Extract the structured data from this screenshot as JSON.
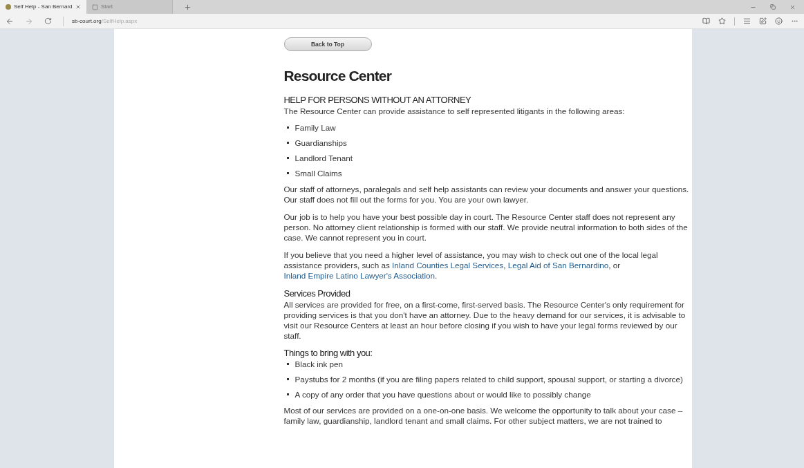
{
  "tabs": [
    {
      "title": "Self Help - San Bernard",
      "selected": true
    },
    {
      "title": "Start",
      "selected": false
    }
  ],
  "address": {
    "domain": "sb-court.org",
    "path": "/SelfHelp.aspx"
  },
  "page": {
    "back_button": "Back to Top",
    "title": "Resource Center",
    "blocks": [
      {
        "kind": "subheading",
        "text": "HELP FOR PERSONS WITHOUT AN ATTORNEY"
      },
      {
        "kind": "lead",
        "parts": [
          {
            "kind": "text",
            "text": "The Resource Center can provide assistance to self represented litigants in the following areas:"
          }
        ]
      },
      {
        "kind": "list",
        "items": [
          "Family Law",
          "Guardianships",
          "Landlord Tenant",
          "Small Claims"
        ]
      },
      {
        "kind": "paragraph",
        "parts": [
          {
            "kind": "text",
            "text": "Our staff of attorneys, paralegals and self help assistants can review your documents and answer your questions. Our staff does not fill out the forms for you. You are your own lawyer."
          }
        ]
      },
      {
        "kind": "paragraph",
        "parts": [
          {
            "kind": "text",
            "text": "Our job is to help you have your best possible day in court. The Resource Center staff does not represent any person. No attorney client relationship is formed with our staff. We provide neutral information to both sides of the case. We cannot represent you in court."
          }
        ]
      },
      {
        "kind": "paragraph",
        "parts": [
          {
            "kind": "text",
            "text": "If you believe that you need a higher level of assistance, you may wish to check out one of the local legal assistance providers, such as "
          },
          {
            "kind": "link",
            "text": "Inland Counties Legal Services"
          },
          {
            "kind": "text",
            "text": ", "
          },
          {
            "kind": "link",
            "text": "Legal Aid of San Bernardino"
          },
          {
            "kind": "text",
            "text": ", or "
          },
          {
            "kind": "link",
            "text": "Inland Empire Latino Lawyer's Association"
          },
          {
            "kind": "text",
            "text": "."
          }
        ]
      },
      {
        "kind": "subheading",
        "text": "Services Provided"
      },
      {
        "kind": "lead",
        "parts": [
          {
            "kind": "text",
            "text": "All services are provided for free, on a first-come, first-served basis. The Resource Center's only requirement for providing services is that you don't have an attorney. Due to the heavy demand for our services, it is advisable to visit our Resource Centers at least an hour before closing if you wish to have your legal forms reviewed by our staff."
          }
        ]
      },
      {
        "kind": "subheading",
        "text": "Things to bring with you:"
      },
      {
        "kind": "list",
        "items": [
          "Black ink pen",
          "Paystubs for 2 months (if you are filing papers related to child support, spousal support, or starting a divorce)",
          "A copy of any order that you have questions about or would like to possibly change"
        ]
      },
      {
        "kind": "paragraph",
        "parts": [
          {
            "kind": "text",
            "text": "Most of our services are provided on a one-on-one basis. We welcome the opportunity to talk about your case – family law, guardianship, landlord tenant and small claims. For other subject matters, we are not trained to"
          }
        ]
      }
    ]
  }
}
